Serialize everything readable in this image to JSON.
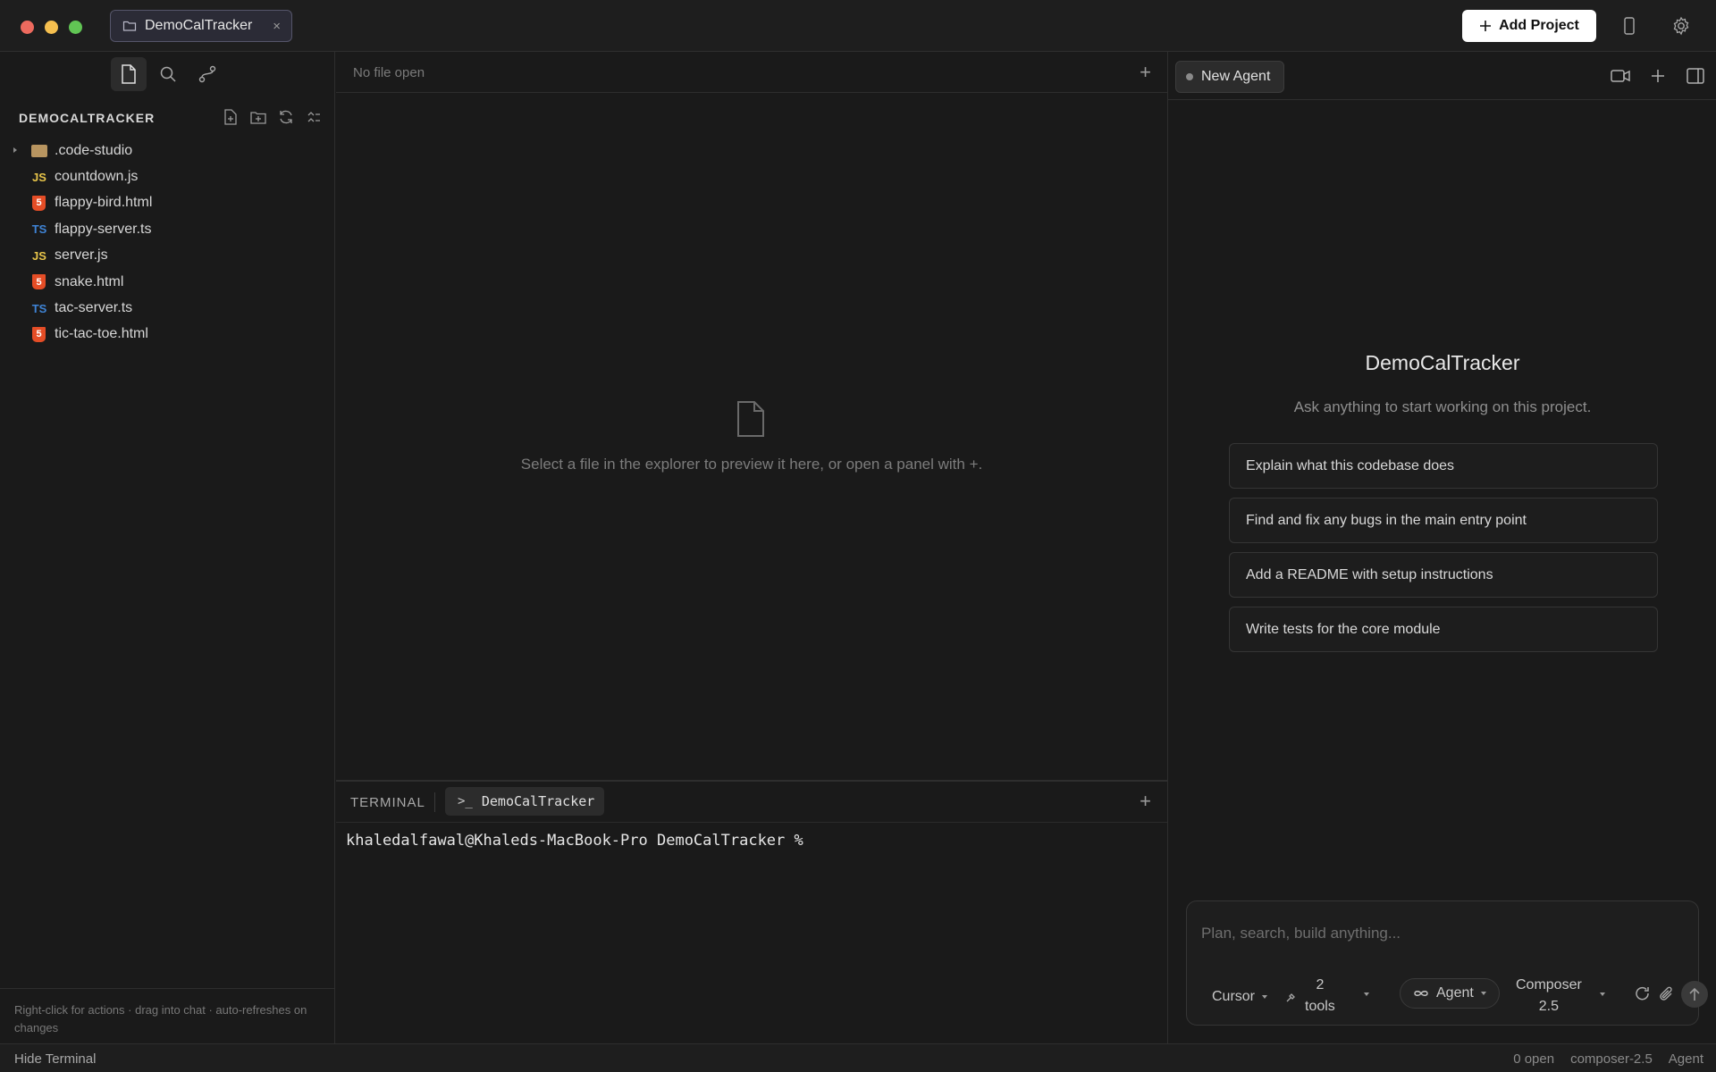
{
  "titlebar": {
    "project_tab": "DemoCalTracker",
    "close_glyph": "×",
    "add_project_label": "Add Project",
    "icons": [
      "folder-icon",
      "close-icon",
      "plus-icon",
      "phone-icon",
      "gear-icon"
    ]
  },
  "sidebar": {
    "toolbar_icons": [
      "file-icon",
      "search-icon",
      "git-branch-icon"
    ],
    "explorer_title": "DEMOCALTRACKER",
    "explorer_actions": [
      "new-file-icon",
      "new-folder-icon",
      "refresh-icon",
      "collapse-icon"
    ],
    "files": [
      {
        "name": ".code-studio",
        "type": "folder",
        "badge": ""
      },
      {
        "name": "countdown.js",
        "type": "js",
        "badge": "JS"
      },
      {
        "name": "flappy-bird.html",
        "type": "html",
        "badge": "5"
      },
      {
        "name": "flappy-server.ts",
        "type": "ts",
        "badge": "TS"
      },
      {
        "name": "server.js",
        "type": "js",
        "badge": "JS"
      },
      {
        "name": "snake.html",
        "type": "html",
        "badge": "5"
      },
      {
        "name": "tac-server.ts",
        "type": "ts",
        "badge": "TS"
      },
      {
        "name": "tic-tac-toe.html",
        "type": "html",
        "badge": "5"
      }
    ],
    "footer_text": "Right-click for actions · drag into chat · auto-refreshes on changes"
  },
  "editor": {
    "no_file_label": "No file open",
    "plus_glyph": "+",
    "empty_message": "Select a file in the explorer to preview it here, or open a panel with +."
  },
  "terminal": {
    "label": "TERMINAL",
    "tab_name": "DemoCalTracker",
    "prompt_glyph": ">_",
    "plus_glyph": "+",
    "prompt_line": "khaledalfawal@Khaleds-MacBook-Pro DemoCalTracker %"
  },
  "agent": {
    "tab_label": "New Agent",
    "header_icons": [
      "video-icon",
      "plus-icon",
      "sidebar-toggle-icon"
    ],
    "welcome_title": "DemoCalTracker",
    "welcome_subtitle": "Ask anything to start working on this project.",
    "suggestions": [
      "Explain what this codebase does",
      "Find and fix any bugs in the main entry point",
      "Add a README with setup instructions",
      "Write tests for the core module"
    ],
    "composer": {
      "placeholder": "Plan, search, build anything...",
      "cursor_label": "Cursor",
      "tools_count": "2",
      "tools_label": "tools",
      "mode_label": "Agent",
      "model_line1": "Composer",
      "model_line2": "2.5"
    }
  },
  "statusbar": {
    "hide_terminal": "Hide Terminal",
    "open_count": "0 open",
    "model": "composer-2.5",
    "mode": "Agent"
  },
  "colors": {
    "background": "#1a1a1a",
    "html_icon": "#e44d26",
    "js_icon": "#e8c54a",
    "ts_icon": "#3f84d6",
    "add_project_bg": "#ffffff"
  }
}
